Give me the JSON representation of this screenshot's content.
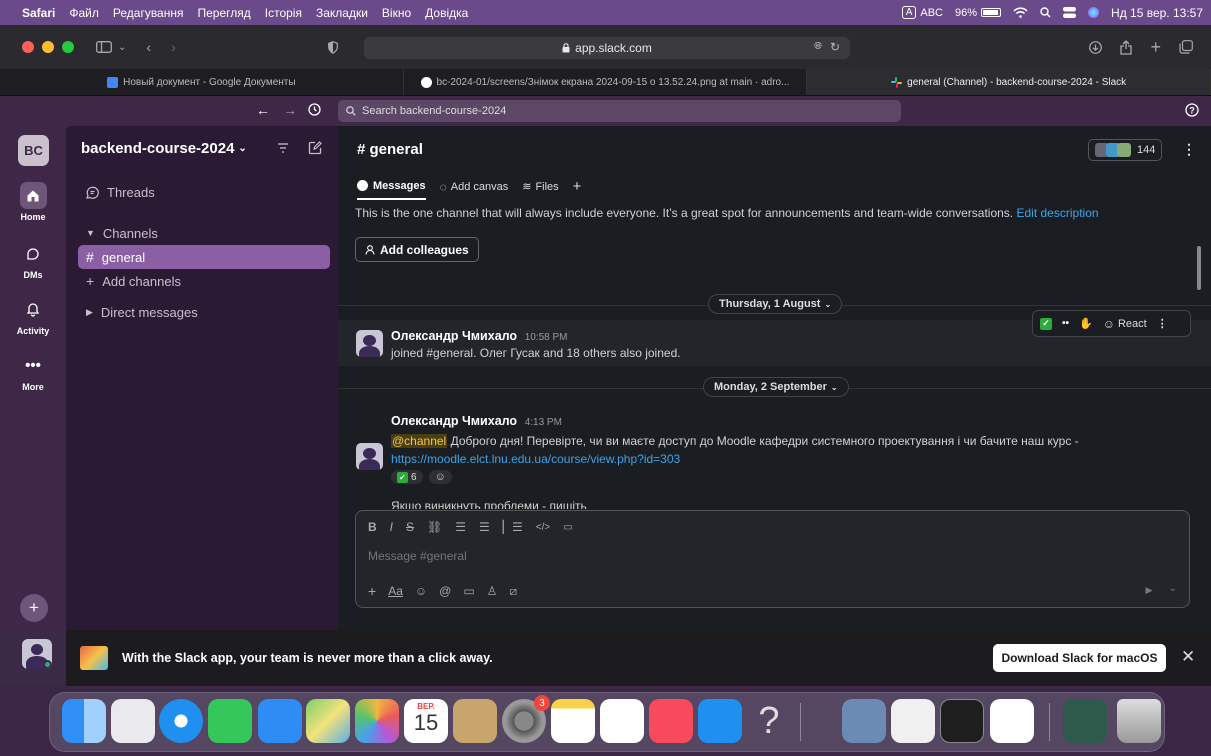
{
  "menubar": {
    "apple": "",
    "items": [
      "Safari",
      "Файл",
      "Редагування",
      "Перегляд",
      "Історія",
      "Закладки",
      "Вікно",
      "Довідка"
    ],
    "input_source": "A",
    "abc": "ABC",
    "battery": "96%",
    "clock": "Нд 15 вер.  13:57"
  },
  "browser": {
    "url": "app.slack.com",
    "tabs": [
      {
        "title": "Новый документ - Google Документы"
      },
      {
        "title": "bc-2024-01/screens/Знімок екрана 2024-09-15 о 13.52.24.png at main · adro..."
      },
      {
        "title": "general (Channel) - backend-course-2024 - Slack"
      }
    ]
  },
  "slack": {
    "search_placeholder": "Search backend-course-2024",
    "rail": {
      "workspace": "BC",
      "items": [
        {
          "label": "Home",
          "icon": "home-icon"
        },
        {
          "label": "DMs",
          "icon": "dms-icon"
        },
        {
          "label": "Activity",
          "icon": "bell-icon"
        },
        {
          "label": "More",
          "icon": "more-icon"
        }
      ]
    },
    "sidebar": {
      "workspace_name": "backend-course-2024",
      "threads": "Threads",
      "channels_header": "Channels",
      "channel": "general",
      "add_channels": "Add channels",
      "dm_header": "Direct messages"
    },
    "channel": {
      "name": "# general",
      "member_count": "144",
      "tabs": {
        "messages": "Messages",
        "canvas": "Add canvas",
        "files": "Files"
      },
      "intro": "This is the one channel that will always include everyone. It’s a great spot for announcements and team-wide conversations.",
      "edit_description": "Edit description",
      "add_colleagues": "Add colleagues"
    },
    "days": [
      "Thursday, 1 August",
      "Monday, 2 September"
    ],
    "messages": [
      {
        "author": "Олександр Чмихало",
        "time": "10:58 PM",
        "text": "joined #general. Олег Гусак and 18 others also joined."
      },
      {
        "author": "Олександр Чмихало",
        "time": "4:13 PM",
        "mention": "@channel",
        "text": "Доброго дня! Перевірте, чи ви маєте доступ до Moodle кафедри системного проектування  і чи бачите наш курс -",
        "link": "https://moodle.elct.lnu.edu.ua/course/view.php?id=303",
        "reaction_count": "6",
        "cut_text": "Якщо виникнуть проблеми - пишіть"
      }
    ],
    "hover_react": "React",
    "composer_placeholder": "Message #general",
    "banner": {
      "text": "With the Slack app, your team is never more than a click away.",
      "button": "Download Slack for macOS"
    }
  },
  "dock": {
    "calendar_month": "ВЕР.",
    "calendar_day": "15",
    "settings_badge": "3"
  }
}
